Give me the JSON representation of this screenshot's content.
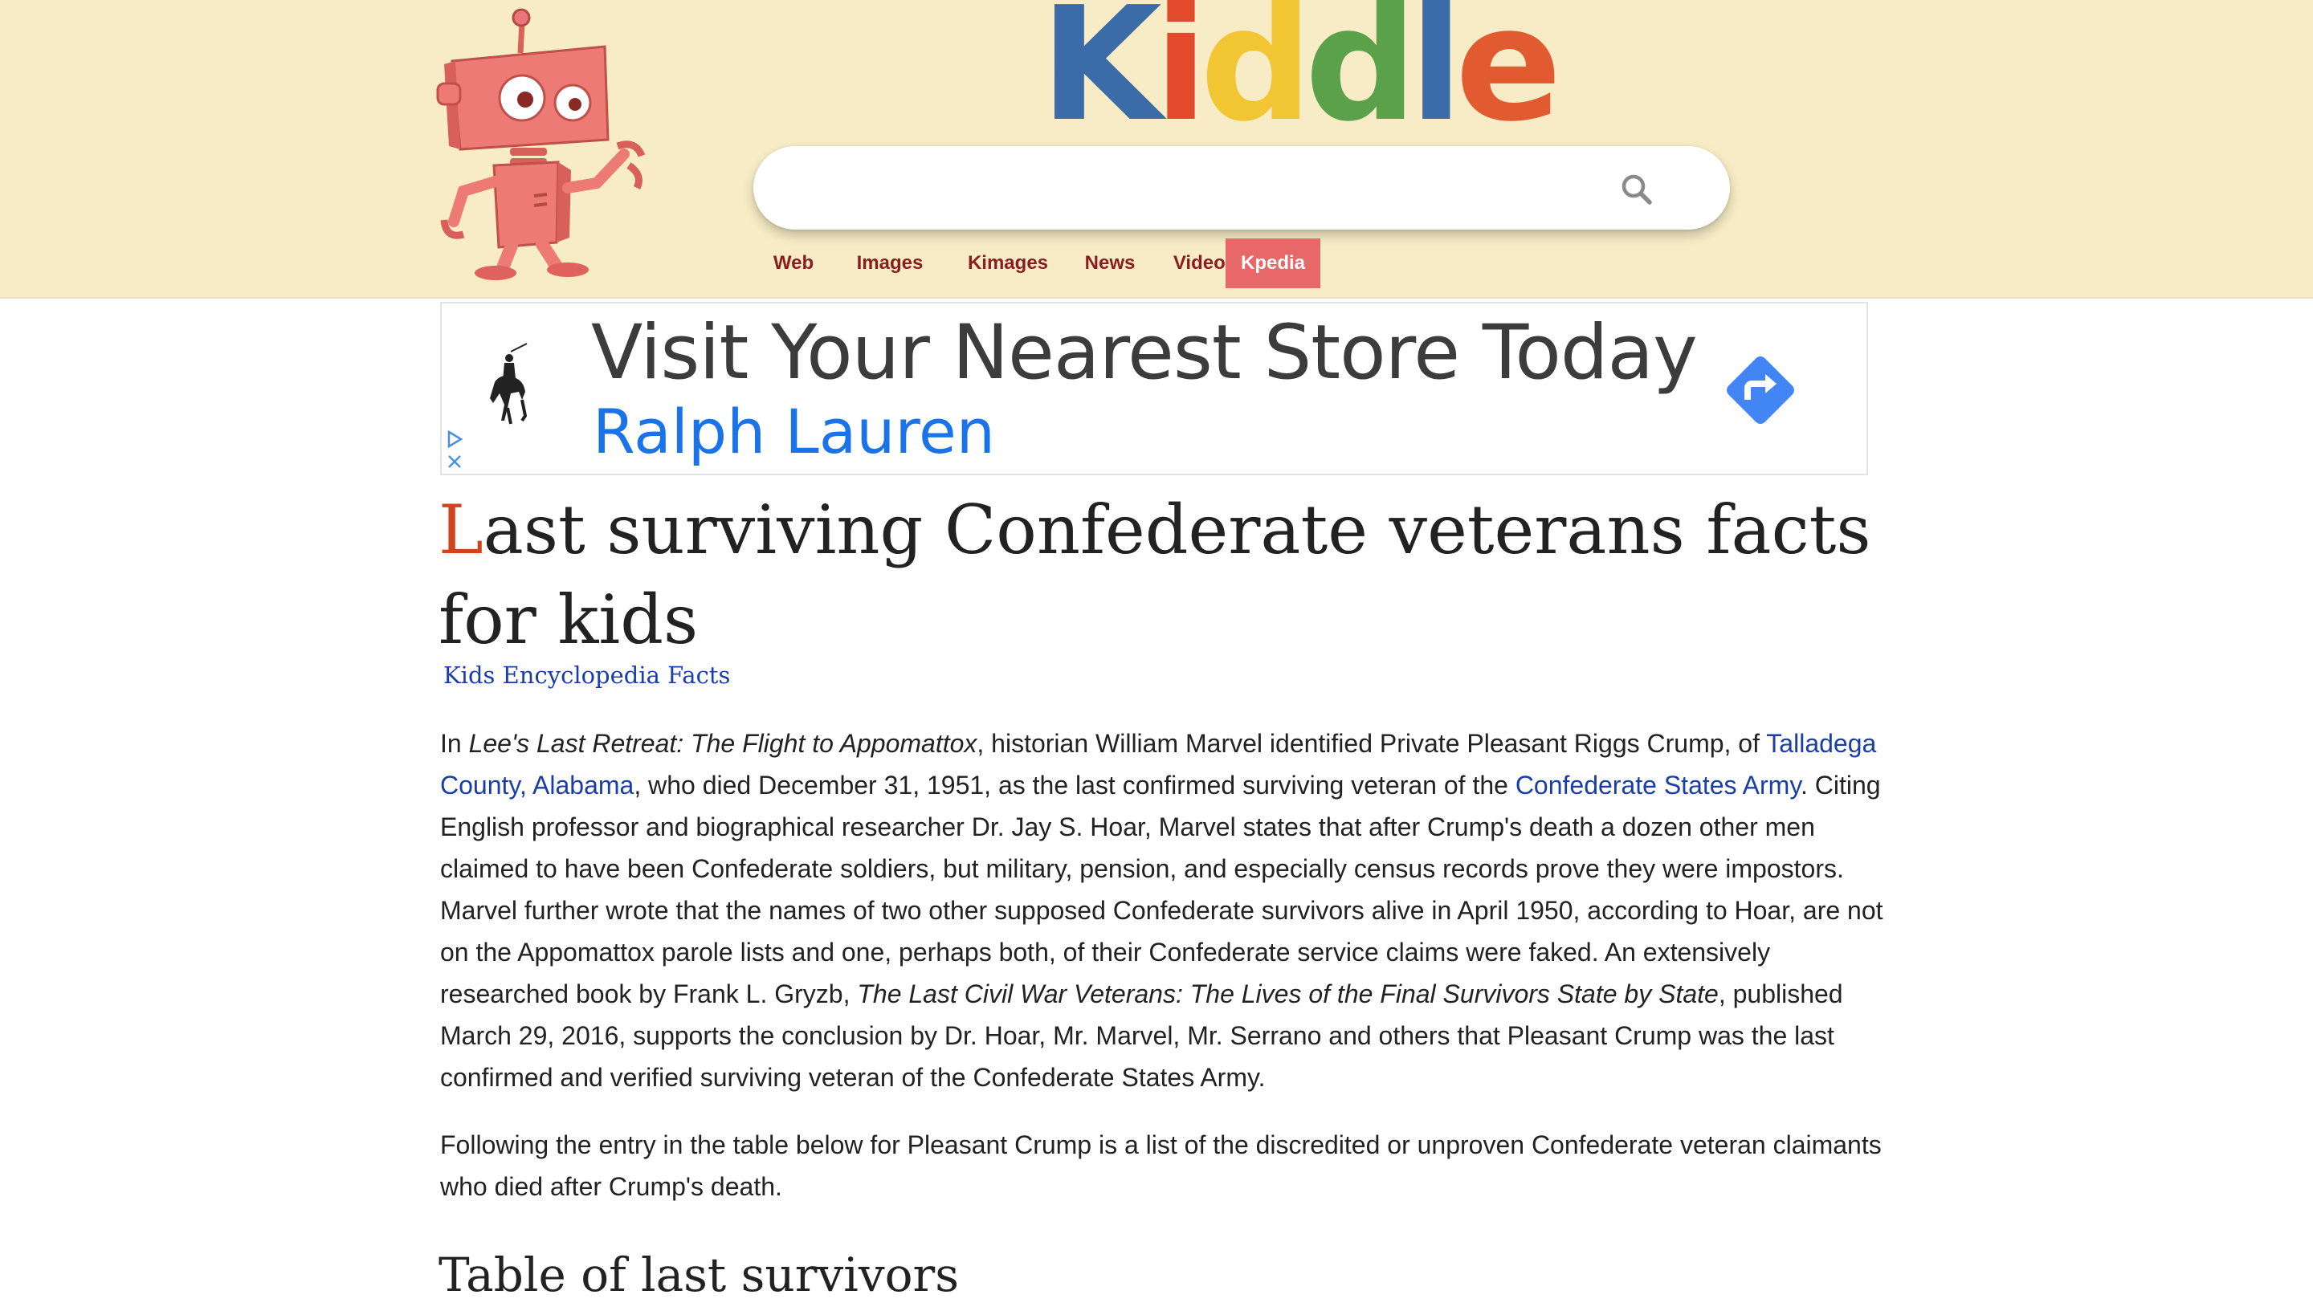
{
  "header": {
    "logo": {
      "letters": [
        "K",
        "i",
        "d",
        "d",
        "l",
        "e"
      ]
    },
    "search": {
      "value": "",
      "placeholder": ""
    },
    "nav_tabs": [
      {
        "label": "Web",
        "active": false
      },
      {
        "label": "Images",
        "active": false
      },
      {
        "label": "Kimages",
        "active": false
      },
      {
        "label": "News",
        "active": false
      },
      {
        "label": "Videos",
        "active": false
      },
      {
        "label": "Kpedia",
        "active": true
      }
    ]
  },
  "ad": {
    "headline": "Visit Your Nearest Store Today",
    "brand": "Ralph Lauren"
  },
  "article": {
    "title_initial": "L",
    "title_rest": "ast surviving Confederate veterans facts for kids",
    "breadcrumb": "Kids Encyclopedia Facts",
    "p1": {
      "t1": "In ",
      "i1": "Lee's Last Retreat: The Flight to Appomattox",
      "t2": ", historian William Marvel identified Private Pleasant Riggs Crump, of ",
      "l1": "Talladega County, Alabama",
      "t3": ", who died December 31, 1951, as the last confirmed surviving veteran of the ",
      "l2": "Confederate States Army",
      "t4": ". Citing English professor and biographical researcher Dr. Jay S. Hoar, Marvel states that after Crump's death a dozen other men claimed to have been Confederate soldiers, but military, pension, and especially census records prove they were impostors. Marvel further wrote that the names of two other supposed Confederate survivors alive in April 1950, according to Hoar, are not on the Appomattox parole lists and one, perhaps both, of their Confederate service claims were faked. An extensively researched book by Frank L. Gryzb, ",
      "i2": "The Last Civil War Veterans: The Lives of the Final Survivors State by State",
      "t5": ", published March 29, 2016, supports the conclusion by Dr. Hoar, Mr. Marvel, Mr. Serrano and others that Pleasant Crump was the last confirmed and verified surviving veteran of the Confederate States Army."
    },
    "p2": "Following the entry in the table below for Pleasant Crump is a list of the discredited or unproven Confederate veteran claimants who died after Crump's death.",
    "section_title": "Table of last survivors"
  },
  "colors": {
    "header_bg": "#f7ecc5",
    "logo_k": "#3b6ca8",
    "logo_i": "#e24a2c",
    "logo_d1": "#f2c532",
    "logo_d2": "#5aa14a",
    "logo_l": "#3b6ca8",
    "logo_e": "#e25a30",
    "nav_text": "#8a1d1d",
    "nav_active_bg": "#e8686a",
    "link": "#1a3da8",
    "title_initial": "#d1431f",
    "ad_brand": "#1a73e8",
    "ad_cta": "#4285f4"
  },
  "icons": {
    "robot": "robot-mascot",
    "search": "magnifier-icon",
    "ad_logo": "polo-player-logo",
    "ad_cta": "turn-right-arrow-icon",
    "adchoices": "adchoices-icon",
    "ad_close": "close-icon"
  }
}
